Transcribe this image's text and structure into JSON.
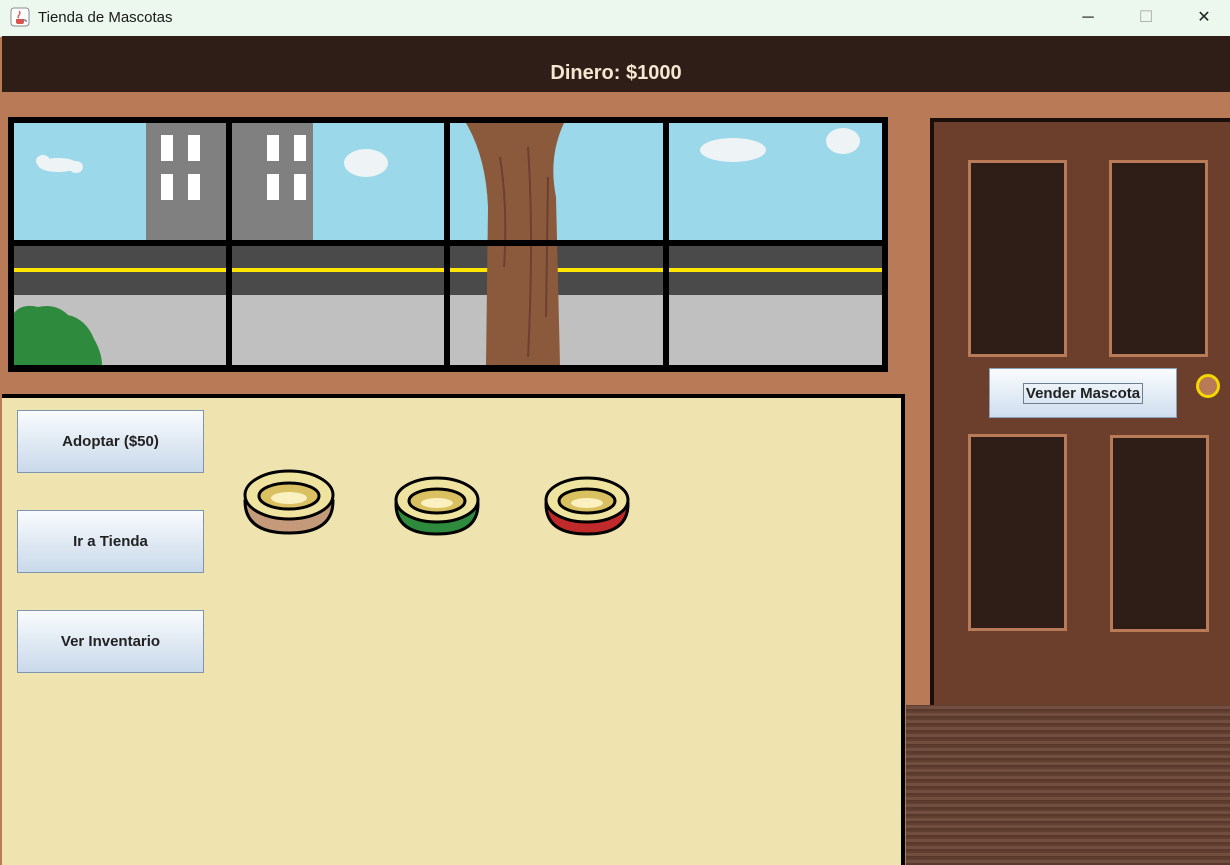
{
  "window": {
    "title": "Tienda de Mascotas",
    "controls": {
      "minimize": "─",
      "maximize": "☐",
      "close": "✕"
    }
  },
  "header": {
    "money": "Dinero: $1000"
  },
  "actions": {
    "adopt": "Adoptar ($50)",
    "store": "Ir a Tienda",
    "inventory": "Ver Inventario"
  },
  "door": {
    "sell": "Vender Mascota"
  },
  "bowls": [
    {
      "name": "brown",
      "color": "#c49a7a"
    },
    {
      "name": "green",
      "color": "#2e8b3e"
    },
    {
      "name": "red",
      "color": "#c02a2a"
    }
  ],
  "colors": {
    "sky": "#9bd8ea",
    "road": "#4a4a4a",
    "road_line": "#ffe500",
    "sidewalk": "#c0c0c0",
    "building": "#808080",
    "tree": "#8b5a3c",
    "bush": "#2e8b3e",
    "wall": "#b97a57",
    "door": "#6b3f2c",
    "panel": "#2e1e17",
    "shop_floor": "#efe3b0"
  }
}
